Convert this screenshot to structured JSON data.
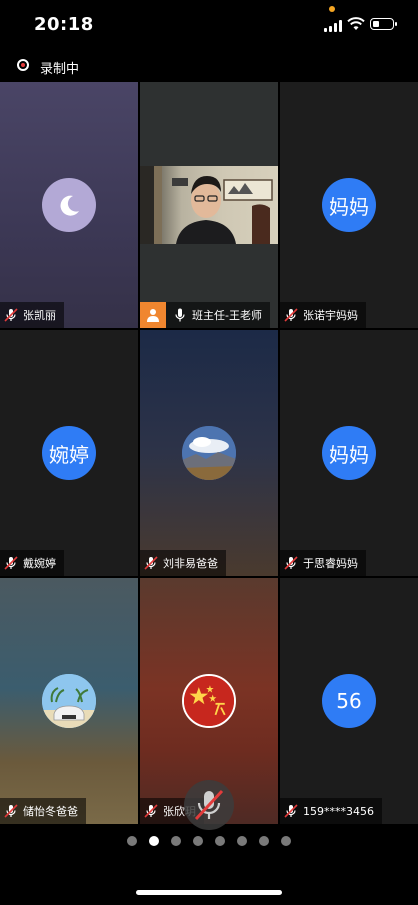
{
  "status_bar": {
    "time": "20:18",
    "battery_level": 0.35
  },
  "recording": {
    "label": "录制中"
  },
  "tiles": [
    {
      "name": "张凯丽",
      "avatar_type": "moon-icon"
    },
    {
      "name": "班主任-王老师",
      "avatar_type": "video",
      "host_badge": "person-icon"
    },
    {
      "name": "张诺宇妈妈",
      "avatar_text": "妈妈"
    },
    {
      "name": "戴婉婷",
      "avatar_text": "婉婷"
    },
    {
      "name": "刘非易爸爸",
      "avatar_type": "landscape-photo"
    },
    {
      "name": "于思睿妈妈",
      "avatar_text": "妈妈"
    },
    {
      "name": "储怡冬爸爸",
      "avatar_type": "car-photo"
    },
    {
      "name": "张欣玥",
      "avatar_type": "flag-photo"
    },
    {
      "name": "159****3456",
      "avatar_text": "56"
    }
  ],
  "pager": {
    "pages": 8,
    "active": 2
  },
  "colors": {
    "avatar_blue": "#2f7cf5",
    "muted_red": "#e23b3b",
    "host_orange": "#f0862f"
  }
}
